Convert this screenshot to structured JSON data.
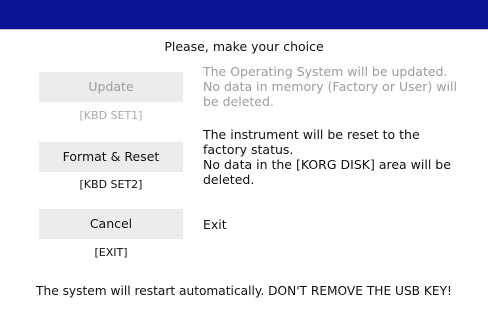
{
  "dialog": {
    "heading": "Please, make your choice",
    "options": [
      {
        "label": "Update",
        "shortcut": "[KBD SET1]",
        "description": "The Operating System will be updated.\nNo data in memory (Factory or User) will be deleted.",
        "enabled": false
      },
      {
        "label": "Format & Reset",
        "shortcut": "[KBD SET2]",
        "description": "The instrument will be reset to the factory status.\nNo data in the [KORG DISK] area will be deleted.",
        "enabled": true
      },
      {
        "label": "Cancel",
        "shortcut": "[EXIT]",
        "description": "Exit",
        "enabled": true
      }
    ],
    "footer": "The system will restart automatically. DON'T REMOVE THE USB KEY!"
  },
  "colors": {
    "titlebar": "#0c1496",
    "button_bg": "#ececec",
    "disabled_text": "#9c9c9c"
  }
}
